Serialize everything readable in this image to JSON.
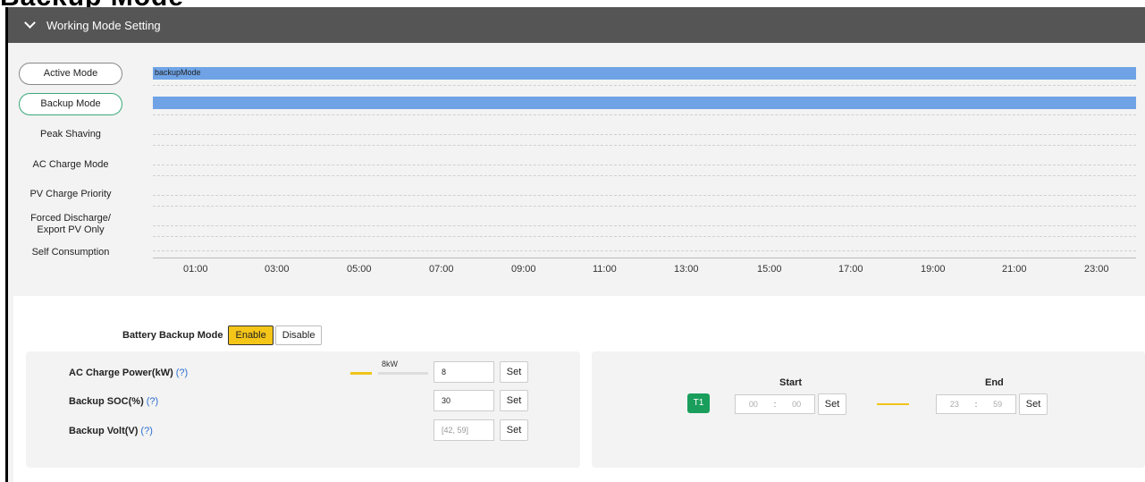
{
  "page_heading": "Backup Mode",
  "header": {
    "title": "Working Mode Setting"
  },
  "modes": [
    {
      "label": "Active Mode"
    },
    {
      "label": "Backup Mode"
    },
    {
      "label": "Peak Shaving"
    },
    {
      "label": "AC Charge Mode"
    },
    {
      "label": "PV Charge Priority"
    },
    {
      "label": "Forced Discharge/",
      "label2": "Export PV Only"
    },
    {
      "label": "Self Consumption"
    }
  ],
  "timeline": {
    "bar_label": "backupMode",
    "ticks": [
      "01:00",
      "03:00",
      "05:00",
      "07:00",
      "09:00",
      "11:00",
      "13:00",
      "15:00",
      "17:00",
      "19:00",
      "21:00",
      "23:00"
    ],
    "bar_color": "#6fa3e6"
  },
  "battery_backup": {
    "label": "Battery Backup Mode",
    "enable": "Enable",
    "disable": "Disable",
    "selected": "Enable"
  },
  "params": {
    "ac_charge": {
      "label": "AC Charge Power(kW)",
      "help": "(?)",
      "value": "8",
      "slider_label": "8kW",
      "set": "Set"
    },
    "backup_soc": {
      "label": "Backup SOC(%)",
      "help": "(?)",
      "value": "30",
      "set": "Set"
    },
    "backup_volt": {
      "label": "Backup Volt(V)",
      "help": "(?)",
      "placeholder": "[42, 59]",
      "set": "Set"
    }
  },
  "schedule": {
    "start_label": "Start",
    "end_label": "End",
    "slot": "T1",
    "start_h": "00",
    "start_m": "00",
    "end_h": "23",
    "end_m": "59",
    "colon": ":",
    "set": "Set"
  },
  "colors": {
    "accent": "#f5c518",
    "green": "#1a9e5c",
    "header": "#555555"
  }
}
